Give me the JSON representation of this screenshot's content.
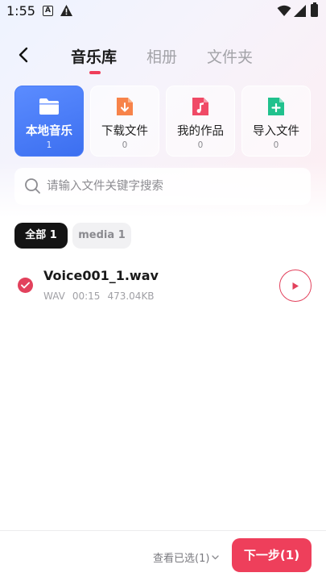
{
  "status_bar": {
    "time": "1:55",
    "notification_letter": "A"
  },
  "header": {
    "tabs": [
      {
        "label": "音乐库",
        "active": true
      },
      {
        "label": "相册",
        "active": false
      },
      {
        "label": "文件夹",
        "active": false
      }
    ]
  },
  "categories": [
    {
      "label": "本地音乐",
      "count": "1",
      "icon": "folder-icon",
      "color": "#ffffff",
      "active": true
    },
    {
      "label": "下载文件",
      "count": "0",
      "icon": "download-file-icon",
      "color": "#f7834a",
      "active": false
    },
    {
      "label": "我的作品",
      "count": "0",
      "icon": "music-file-icon",
      "color": "#f04a66",
      "active": false
    },
    {
      "label": "导入文件",
      "count": "0",
      "icon": "add-file-icon",
      "color": "#21c18d",
      "active": false
    }
  ],
  "search": {
    "placeholder": "请输入文件关键字搜索",
    "value": ""
  },
  "filters": [
    {
      "label": "全部 1",
      "active": true
    },
    {
      "label": "media 1",
      "active": false
    }
  ],
  "files": [
    {
      "name": "Voice001_1.wav",
      "format": "WAV",
      "duration": "00:15",
      "size": "473.04KB",
      "selected": true
    }
  ],
  "footer": {
    "view_selected_label": "查看已选(1)",
    "next_label": "下一步(1)"
  },
  "colors": {
    "accent": "#ee3f5b",
    "active_card": "#4a7cf7",
    "chip_active": "#141414"
  }
}
